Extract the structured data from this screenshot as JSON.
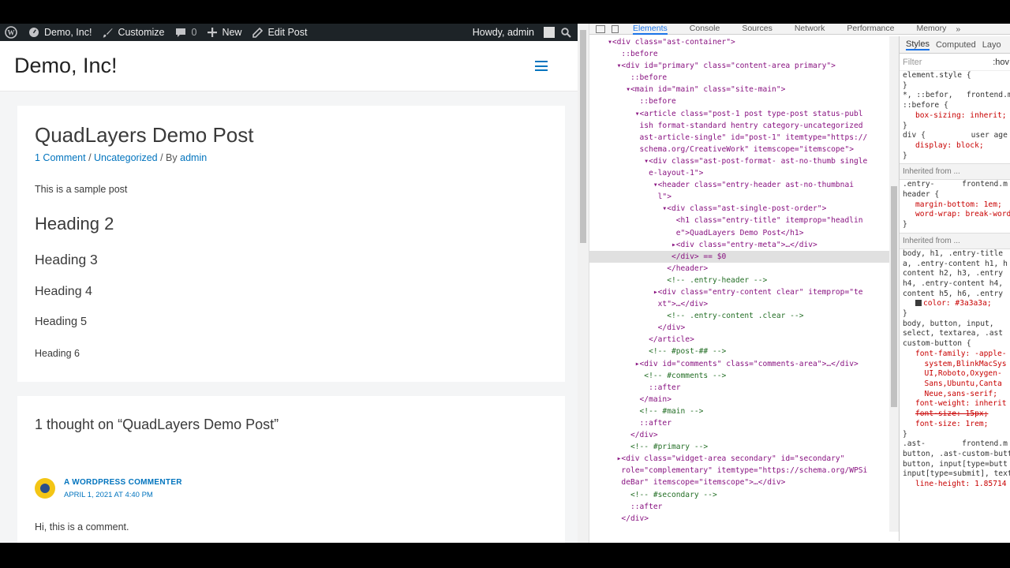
{
  "admin_bar": {
    "site_name": "Demo, Inc!",
    "customize": "Customize",
    "comments_count": "0",
    "new": "New",
    "edit_post": "Edit Post",
    "howdy": "Howdy, admin"
  },
  "site": {
    "title": "Demo, Inc!"
  },
  "post": {
    "title": "QuadLayers Demo Post",
    "meta_comments": "1 Comment",
    "meta_sep1": " / ",
    "meta_category": "Uncategorized",
    "meta_sep2": " / By ",
    "meta_author": "admin",
    "intro": "This is a sample post",
    "headings": {
      "h2": "Heading 2",
      "h3": "Heading 3",
      "h4": "Heading 4",
      "h5": "Heading 5",
      "h6": "Heading 6"
    }
  },
  "comments": {
    "title": "1 thought on “QuadLayers Demo Post”",
    "author": "A WORDPRESS COMMENTER",
    "date": "APRIL 1, 2021 AT 4:40 PM",
    "text": "Hi, this is a comment."
  },
  "devtools": {
    "tabs": [
      "Elements",
      "Console",
      "Sources",
      "Network",
      "Performance",
      "Memory"
    ],
    "more": "»",
    "dom_lines": [
      "    ▾<div class=\"ast-container\">",
      "       ::before",
      "      ▾<div id=\"primary\" class=\"content-area primary\">",
      "         ::before",
      "        ▾<main id=\"main\" class=\"site-main\">",
      "           ::before",
      "          ▾<article class=\"post-1 post type-post status-publ",
      "           ish format-standard hentry category-uncategorized",
      "           ast-article-single\" id=\"post-1\" itemtype=\"https://",
      "           schema.org/CreativeWork\" itemscope=\"itemscope\">",
      "            ▾<div class=\"ast-post-format- ast-no-thumb single",
      "             e-layout-1\">",
      "              ▾<header class=\"entry-header ast-no-thumbnai",
      "               l\">",
      "                ▾<div class=\"ast-single-post-order\">",
      "                   <h1 class=\"entry-title\" itemprop=\"headlin",
      "                   e\">QuadLayers Demo Post</h1>",
      "                  ▸<div class=\"entry-meta\">…</div>",
      "                  </div> == $0",
      "                 </header>",
      "                 <!-- .entry-header -->",
      "              ▸<div class=\"entry-content clear\" itemprop=\"te",
      "               xt\">…</div>",
      "                 <!-- .entry-content .clear -->",
      "               </div>",
      "             </article>",
      "             <!-- #post-## -->",
      "          ▸<div id=\"comments\" class=\"comments-area\">…</div>",
      "            <!-- #comments -->",
      "             ::after",
      "           </main>",
      "           <!-- #main -->",
      "           ::after",
      "         </div>",
      "         <!-- #primary -->",
      "      ▸<div class=\"widget-area secondary\" id=\"secondary\"",
      "       role=\"complementary\" itemtype=\"https://schema.org/WPSi",
      "       deBar\" itemscope=\"itemscope\">…</div>",
      "         <!-- #secondary -->",
      "         ::after",
      "       </div>"
    ],
    "selected_line": 18,
    "styles_tabs": [
      "Styles",
      "Computed",
      "Layo"
    ],
    "filter_placeholder": "Filter",
    "hov": ":hov",
    "style_lines": [
      {
        "t": "element.style {",
        "k": "sel"
      },
      {
        "t": "}",
        "k": "sel"
      },
      {
        "t": "*, ::befor,   frontend.m",
        "k": "sel"
      },
      {
        "t": "::before {",
        "k": "sel"
      },
      {
        "t": "box-sizing: inherit;",
        "k": "prop"
      },
      {
        "t": "}",
        "k": "sel"
      },
      {
        "t": "div {          user age",
        "k": "sel"
      },
      {
        "t": "display: block;",
        "k": "prop"
      },
      {
        "t": "}",
        "k": "sel"
      },
      {
        "t": "Inherited from ...",
        "k": "head"
      },
      {
        "t": ".entry-      frontend.m",
        "k": "sel"
      },
      {
        "t": "header {",
        "k": "sel"
      },
      {
        "t": "margin-bottom: 1em;",
        "k": "prop"
      },
      {
        "t": "word-wrap: break-word",
        "k": "prop"
      },
      {
        "t": "}",
        "k": "sel"
      },
      {
        "t": "Inherited from ...",
        "k": "head"
      },
      {
        "t": "body, h1, .entry-title",
        "k": "sel"
      },
      {
        "t": "a, .entry-content h1, h",
        "k": "sel"
      },
      {
        "t": "content h2, h3, .entry",
        "k": "sel"
      },
      {
        "t": "h4, .entry-content h4,",
        "k": "sel"
      },
      {
        "t": "content h5, h6, .entry",
        "k": "sel"
      },
      {
        "t": "color: #3a3a3a;",
        "k": "color"
      },
      {
        "t": "}",
        "k": "sel"
      },
      {
        "t": "body, button, input,",
        "k": "sel"
      },
      {
        "t": "select, textarea, .ast",
        "k": "sel"
      },
      {
        "t": "custom-button {",
        "k": "sel"
      },
      {
        "t": "font-family: -apple-",
        "k": "prop"
      },
      {
        "t": "  system,BlinkMacSys",
        "k": "prop"
      },
      {
        "t": "  UI,Roboto,Oxygen-",
        "k": "prop"
      },
      {
        "t": "  Sans,Ubuntu,Canta",
        "k": "prop"
      },
      {
        "t": "  Neue,sans-serif;",
        "k": "prop"
      },
      {
        "t": "font-weight: inherit",
        "k": "prop"
      },
      {
        "t": "font-size: 15px;",
        "k": "strike"
      },
      {
        "t": "font-size: 1rem;",
        "k": "prop"
      },
      {
        "t": "}",
        "k": "sel"
      },
      {
        "t": ".ast-        frontend.m",
        "k": "sel"
      },
      {
        "t": "button, .ast-custom-butt",
        "k": "sel"
      },
      {
        "t": "button, input[type=butt",
        "k": "sel"
      },
      {
        "t": "input[type=submit], text",
        "k": "sel"
      },
      {
        "t": "line-height: 1.85714",
        "k": "prop"
      }
    ]
  },
  "colors": {
    "link": "#0274be",
    "text": "#3a3a3a",
    "adminbar": "#1d2327",
    "devtools_accent": "#1a73e8"
  }
}
